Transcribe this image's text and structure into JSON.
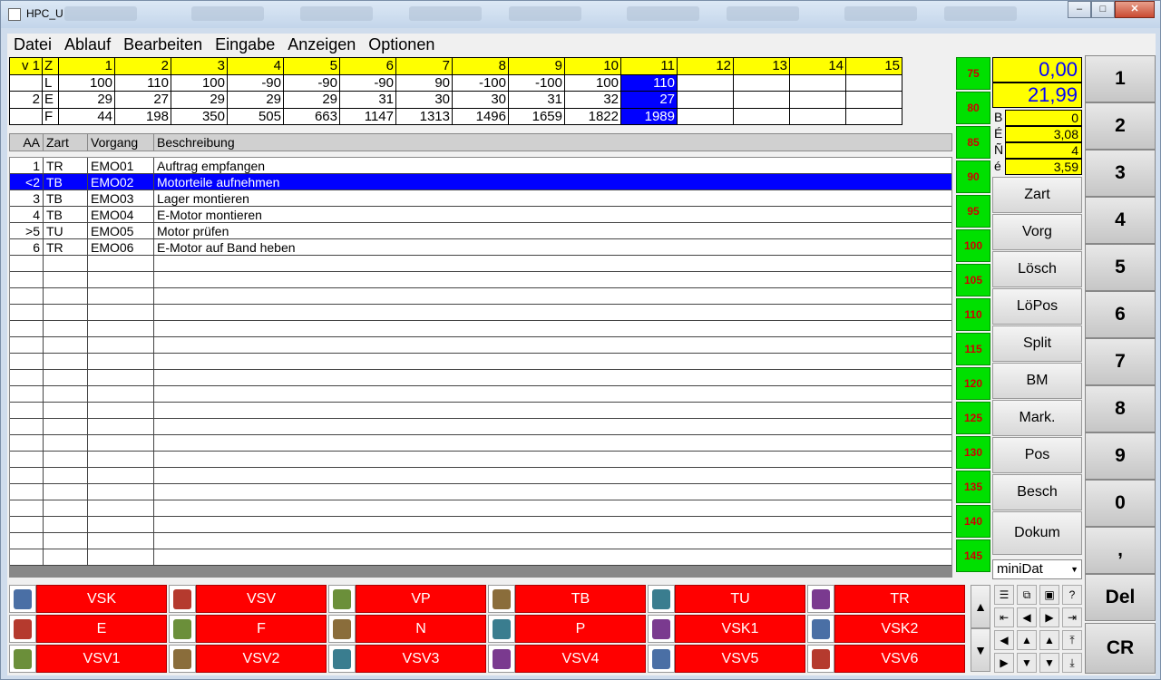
{
  "window": {
    "title": "HPC_U"
  },
  "menu": [
    "Datei",
    "Ablauf",
    "Bearbeiten",
    "Eingabe",
    "Anzeigen",
    "Optionen"
  ],
  "topgrid": {
    "header": [
      "v 1",
      "Z",
      "1",
      "2",
      "3",
      "4",
      "5",
      "6",
      "7",
      "8",
      "9",
      "10",
      "11",
      "12",
      "13",
      "14",
      "15"
    ],
    "rows": [
      [
        "",
        "L",
        "100",
        "110",
        "100",
        "-90",
        "-90",
        "-90",
        "90",
        "-100",
        "-100",
        "100",
        "110",
        "",
        "",
        "",
        ""
      ],
      [
        "2",
        "E",
        "29",
        "27",
        "29",
        "29",
        "29",
        "31",
        "30",
        "30",
        "31",
        "32",
        "27",
        "",
        "",
        "",
        ""
      ],
      [
        "",
        "F",
        "44",
        "198",
        "350",
        "505",
        "663",
        "1147",
        "1313",
        "1496",
        "1659",
        "1822",
        "1989",
        "",
        "",
        "",
        ""
      ]
    ],
    "selected_column": 11
  },
  "list": {
    "headers": [
      "AA",
      "Zart",
      "Vorgang",
      "Beschreibung"
    ],
    "rows": [
      [
        "1",
        "TR",
        "EMO01",
        "Auftrag empfangen"
      ],
      [
        "<2",
        "TB",
        "EMO02",
        "Motorteile aufnehmen"
      ],
      [
        "3",
        "TB",
        "EMO03",
        "Lager montieren"
      ],
      [
        "4",
        "TB",
        "EMO04",
        "E-Motor montieren"
      ],
      [
        ">5",
        "TU",
        "EMO05",
        "Motor prüfen"
      ],
      [
        "6",
        "TR",
        "EMO06",
        "E-Motor auf Band heben"
      ]
    ],
    "selected_row": 1
  },
  "scale": [
    "75",
    "80",
    "85",
    "90",
    "95",
    "100",
    "105",
    "110",
    "115",
    "120",
    "125",
    "130",
    "135",
    "140",
    "145"
  ],
  "display": {
    "value1": "0,00",
    "value2": "21,99",
    "fields": [
      {
        "key": "B",
        "value": "0"
      },
      {
        "key": "É",
        "value": "3,08"
      },
      {
        "key": "Ñ",
        "value": "4"
      },
      {
        "key": "é",
        "value": "3,59"
      }
    ]
  },
  "func_buttons": [
    "Zart",
    "Vorg",
    "Lösch",
    "LöPos",
    "Split",
    "BM",
    "Mark.",
    "Pos",
    "Besch",
    "Dokum"
  ],
  "combo": {
    "value": "miniDat"
  },
  "numpad": [
    "1",
    "2",
    "3",
    "4",
    "5",
    "6",
    "7",
    "8",
    "9",
    "0",
    ",",
    "Del",
    "CR"
  ],
  "bottom_buttons": [
    [
      "VSK",
      "VSV",
      "VP",
      "TB",
      "TU",
      "TR"
    ],
    [
      "E",
      "F",
      "N",
      "P",
      "VSK1",
      "VSK2"
    ],
    [
      "VSV1",
      "VSV2",
      "VSV3",
      "VSV4",
      "VSV5",
      "VSV6"
    ]
  ],
  "colors": {
    "grid_header": "#ffff00",
    "selection": "#0000ff",
    "action_button": "#ff0000",
    "scale": "#00e000"
  }
}
